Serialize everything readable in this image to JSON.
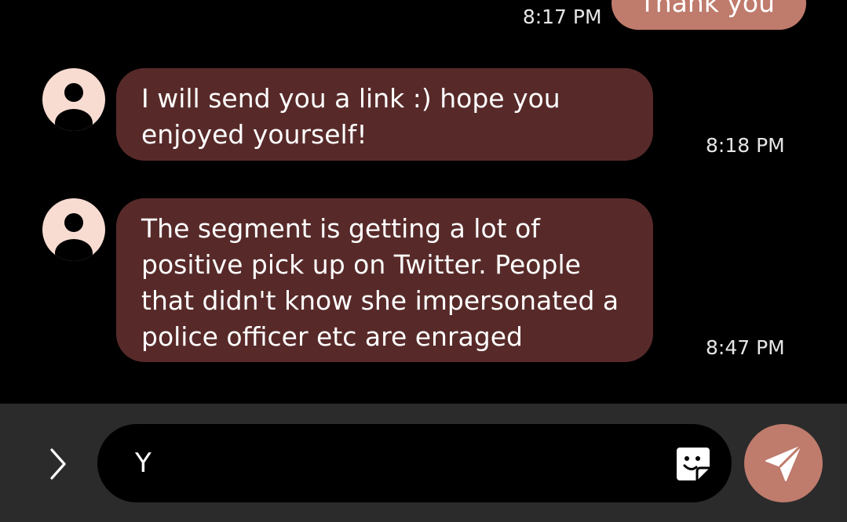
{
  "conversation": {
    "outgoing": [
      {
        "text": "Thank you",
        "time": "8:17 PM"
      }
    ],
    "incoming": [
      {
        "text": "I will send you a link :) hope you enjoyed yourself!",
        "time": "8:18 PM"
      },
      {
        "text": "The segment is getting a lot of positive pick up on Twitter. People that didn't know she impersonated a police officer etc are enraged",
        "time": "8:47 PM"
      }
    ]
  },
  "composer": {
    "value": "Y",
    "expand_icon": "chevron-right-icon",
    "sticker_icon": "sticker-icon",
    "send_icon": "send-icon"
  },
  "colors": {
    "background": "#000000",
    "incoming_bubble": "#572a29",
    "outgoing_bubble": "#bf7b6c",
    "avatar_bg": "#f8dcd2",
    "input_bar": "#2b2b2b",
    "send_button": "#bf7b6c"
  }
}
